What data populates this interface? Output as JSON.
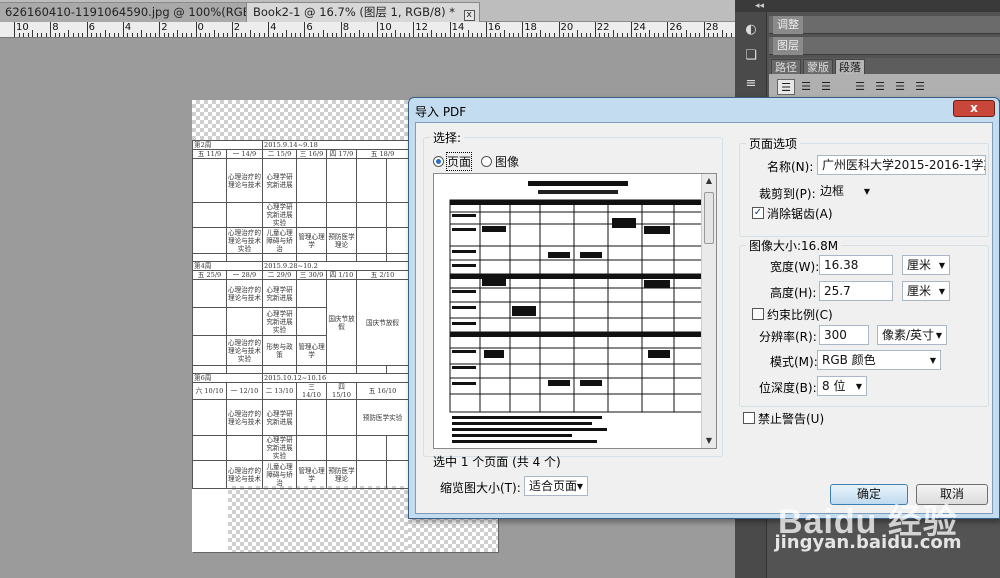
{
  "tabs": [
    {
      "title": "626160410-1191064590.jpg @ 100%(RGB/8#)",
      "close": "⊠"
    },
    {
      "title": "Book2-1 @ 16.7% (图层 1, RGB/8) *",
      "close": "⊠"
    }
  ],
  "ruler": {
    "labels": [
      "10",
      "8",
      "6",
      "4",
      "2",
      "0",
      "2",
      "4",
      "6",
      "8",
      "10",
      "12",
      "14",
      "16",
      "18",
      "20",
      "22",
      "24",
      "26",
      "28"
    ]
  },
  "schedule": {
    "weeks": [
      "第2周",
      "第4周",
      "第6周"
    ],
    "dates": [
      "2015.9.14~9.18",
      "2015.9.28~10.2",
      "2015.10.12~10.16"
    ],
    "day_row_1": [
      "五 11/9",
      "一 14/9",
      "二 15/9",
      "三 16/9",
      "四 17/9",
      "五 18/9"
    ],
    "day_row_2": [
      "五 25/9",
      "一 28/9",
      "二 29/9",
      "三 30/9",
      "四 1/10",
      "五 2/10"
    ],
    "day_row_3": [
      "六 10/10",
      "一 12/10",
      "二 13/10",
      "三 14/10",
      "四 15/10",
      "五 16/10"
    ],
    "course_a": "心理治疗的理论与技术",
    "course_b": "心理学研究新进展",
    "course_c": "心理学研究新进展实验",
    "course_d": "心理治疗的理论与技术实验",
    "course_e": "儿童心理障碍与矫治",
    "course_f": "管理心理学",
    "course_g": "预防医学理论",
    "course_h": "国庆节放假",
    "course_i": "形势与政策",
    "course_j": "预防医学实验"
  },
  "panel": {
    "collapse": "◂◂",
    "tab_adjust": "调整",
    "tab_layers": "图层",
    "tab_paths": "路径",
    "tab_styles": "蒙版",
    "tab_paragraph": "段落"
  },
  "dialog": {
    "title": "导入 PDF",
    "close": "x",
    "select_legend": "选择:",
    "radio_page": "页面",
    "radio_image": "图像",
    "selected_info": "选中 1 个页面 (共 4 个)",
    "thumb_size_label": "缩览图大小(T):",
    "thumb_size_value": "适合页面",
    "page_options_legend": "页面选项",
    "name_label": "名称(N):",
    "name_value": "广州医科大学2015-2016-1学期2",
    "crop_label": "裁剪到(P):",
    "crop_value": "边框",
    "antialias_label": "消除锯齿(A)",
    "image_size_legend": "图像大小:16.8M",
    "width_label": "宽度(W):",
    "width_value": "16.38",
    "width_unit": "厘米",
    "height_label": "高度(H):",
    "height_value": "25.7",
    "height_unit": "厘米",
    "constrain_label": "约束比例(C)",
    "res_label": "分辨率(R):",
    "res_value": "300",
    "res_unit": "像素/英寸",
    "mode_label": "模式(M):",
    "mode_value": "RGB 颜色",
    "depth_label": "位深度(B):",
    "depth_value": "8 位",
    "suppress_label": "禁止警告(U)",
    "ok_label": "确定",
    "cancel_label": "取消"
  },
  "watermark": {
    "logo": "Baidu 经验",
    "url": "jingyan.baidu.com"
  }
}
